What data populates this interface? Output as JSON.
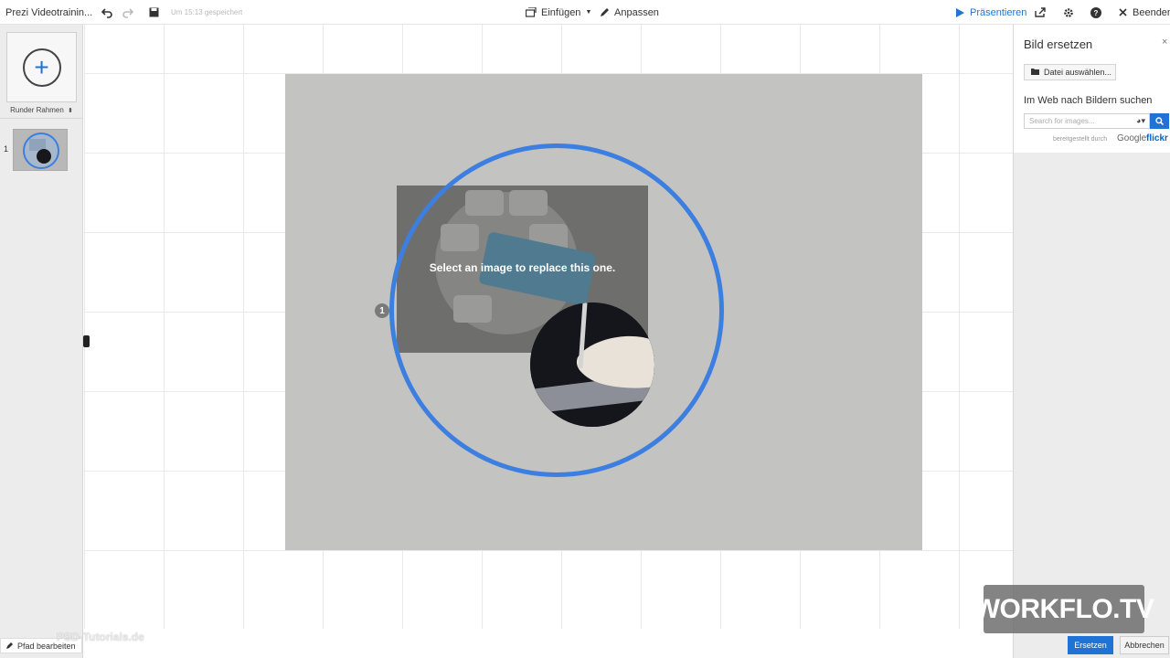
{
  "app": {
    "title": "Prezi Videotrainin...",
    "saved_status": "Um 15:13 gespeichert"
  },
  "toolbar": {
    "insert_label": "Einfügen",
    "customize_label": "Anpassen",
    "present_label": "Präsentieren",
    "exit_label": "Beenden"
  },
  "left_panel": {
    "frame_type": "Runder Rahmen",
    "slides": [
      {
        "number": "1"
      }
    ]
  },
  "canvas": {
    "replace_prompt": "Select an image to replace this one.",
    "path_step": "1"
  },
  "right_panel": {
    "title": "Bild ersetzen",
    "close_label": "×",
    "choose_file_label": "Datei auswählen...",
    "web_search_title": "Im Web nach Bildern suchen",
    "search_placeholder": "Search for images...",
    "provided_by": "bereitgestellt durch",
    "provider_google": "Google",
    "provider_flickr": "flickr"
  },
  "bottom": {
    "edit_path_label": "Pfad bearbeiten",
    "replace_button": "Ersetzen",
    "cancel_button": "Abbrechen",
    "watermark_left": "PSD-Tutorials.de",
    "watermark_right": "WORKFLO.TV"
  },
  "colors": {
    "accent": "#1f73d6",
    "ring": "#3d7fe0",
    "slide_bg": "#c3c3c1"
  },
  "icons": [
    "undo-icon",
    "redo-icon",
    "save-icon",
    "insert-icon",
    "pencil-icon",
    "play-icon",
    "share-icon",
    "gear-icon",
    "help-icon",
    "close-icon",
    "plus-icon",
    "folder-icon",
    "globe-icon",
    "search-icon",
    "edit-path-icon"
  ]
}
